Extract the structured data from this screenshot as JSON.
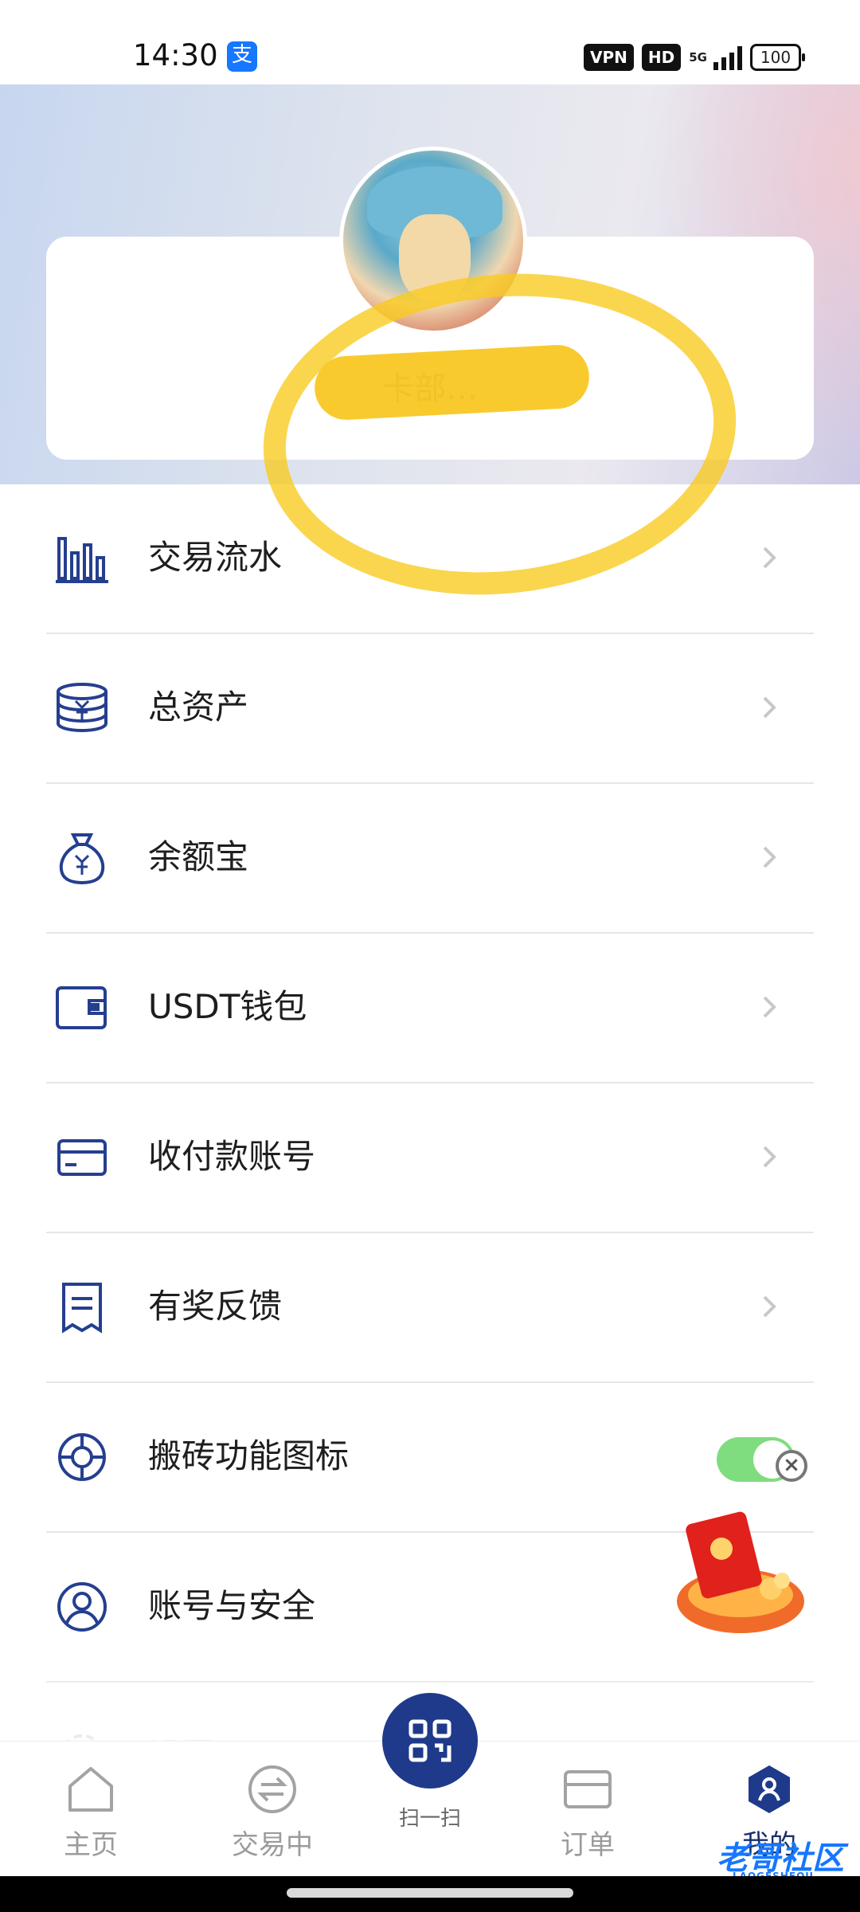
{
  "status_bar": {
    "time": "14:30",
    "alipay_glyph": "支",
    "vpn": "VPN",
    "hd": "HD",
    "network": "5G",
    "battery": "100"
  },
  "profile": {
    "username": "卡部…"
  },
  "menu": [
    {
      "label": "交易流水",
      "icon": "bar-chart-icon"
    },
    {
      "label": "总资产",
      "icon": "coin-stack-icon"
    },
    {
      "label": "余额宝",
      "icon": "money-bag-icon"
    },
    {
      "label": "USDT钱包",
      "icon": "wallet-icon"
    },
    {
      "label": "收付款账号",
      "icon": "card-icon"
    },
    {
      "label": "有奖反馈",
      "icon": "receipt-icon"
    },
    {
      "label": "搬砖功能图标",
      "icon": "lifebuoy-icon",
      "toggle_on": true
    },
    {
      "label": "账号与安全",
      "icon": "user-shield-icon"
    },
    {
      "label": "设置",
      "icon": "gear-icon"
    }
  ],
  "tabbar": {
    "home": "主页",
    "trading": "交易中",
    "scan": "扫一扫",
    "orders": "订单",
    "mine": "我的"
  },
  "watermark": {
    "text": "老哥社区",
    "sub": "LAOGESHEQU"
  },
  "colors": {
    "accent": "#1f3a8a",
    "icon": "#253f8f",
    "toggle": "#7fdc7f",
    "highlight": "#f7c51c"
  }
}
